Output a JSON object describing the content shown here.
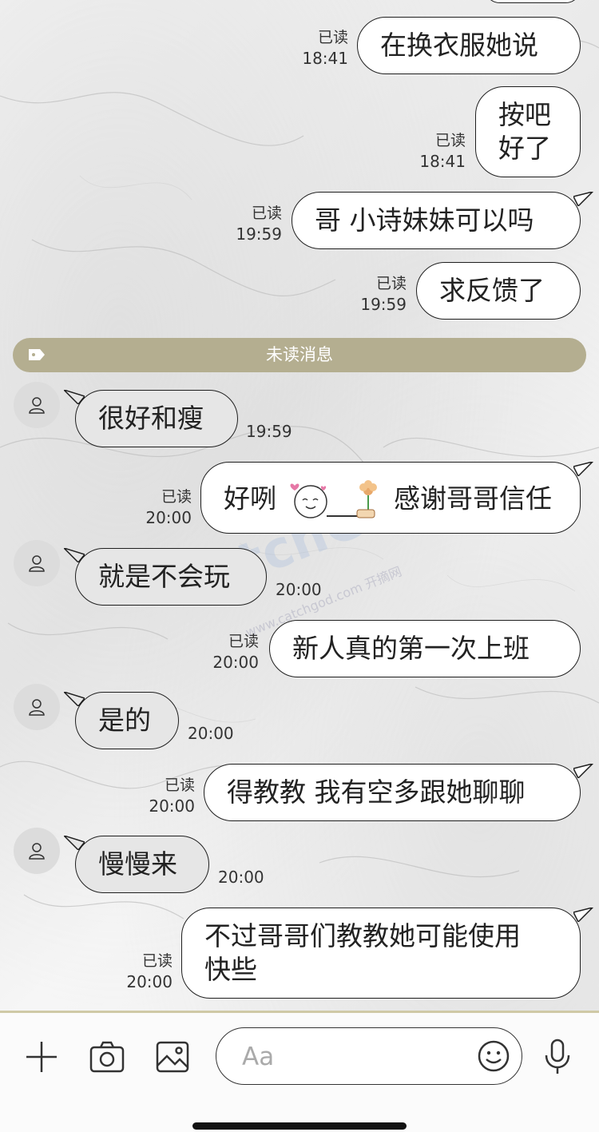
{
  "messages_out_1": {
    "text": "在换衣服她说",
    "read": "已读",
    "time": "18:41"
  },
  "messages_out_2": {
    "text": "按吧好了",
    "line1": "按吧",
    "line2": "好了",
    "read": "已读",
    "time": "18:41"
  },
  "messages_out_3": {
    "text": "哥 小诗妹妹可以吗",
    "read": "已读",
    "time": "19:59"
  },
  "messages_out_4": {
    "text": "求反馈了",
    "read": "已读",
    "time": "19:59"
  },
  "unread_divider": "未读消息",
  "messages_in_1": {
    "text": "很好和瘦",
    "time": "19:59"
  },
  "messages_out_5": {
    "before": "好咧",
    "after": "感谢哥哥信任",
    "read": "已读",
    "time": "20:00"
  },
  "messages_in_2": {
    "text": "就是不会玩",
    "time": "20:00"
  },
  "messages_out_6": {
    "text": "新人真的第一次上班",
    "read": "已读",
    "time": "20:00"
  },
  "messages_in_3": {
    "text": "是的",
    "time": "20:00"
  },
  "messages_out_7": {
    "text": "得教教 我有空多跟她聊聊",
    "read": "已读",
    "time": "20:00"
  },
  "messages_in_4": {
    "text": "慢慢来",
    "time": "20:00"
  },
  "messages_out_8": {
    "line1": "不过哥哥们教教她可能使用",
    "line2": "快些",
    "read": "已读",
    "time": "20:00"
  },
  "watermark": {
    "main": "CatchGod",
    "sub": "www.catchgod.com 开摘网"
  },
  "input": {
    "placeholder": "Aa"
  },
  "icons": [
    "plus-icon",
    "camera-icon",
    "image-icon",
    "emoji-icon",
    "microphone-icon",
    "person-icon",
    "tag-icon"
  ],
  "colors": {
    "outgoing_bubble": "#ffffff",
    "incoming_bubble": "#e6e6e6",
    "unread_bar": "#b4ae90",
    "border": "#1f1f1f"
  }
}
